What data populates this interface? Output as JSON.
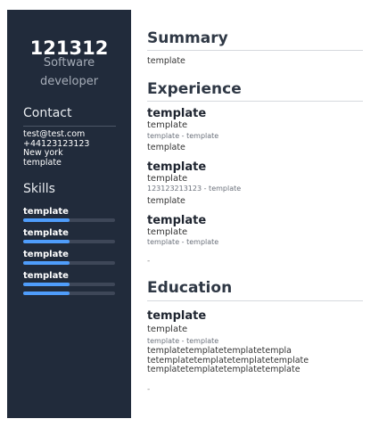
{
  "sidebar": {
    "name": "121312",
    "role_line1": "Software",
    "role_line2": "developer",
    "contact_heading": "Contact",
    "contact": [
      "test@test.com",
      "+44123123123",
      "New york",
      "template"
    ],
    "skills_heading": "Skills",
    "skills": [
      {
        "label": "template",
        "level": 0.5
      },
      {
        "label": "template",
        "level": 0.5
      },
      {
        "label": "template",
        "level": 0.5
      },
      {
        "label": "template",
        "level": 0.5
      }
    ],
    "colors": {
      "background": "#212b3b",
      "skill_fill": "#4f9dfb",
      "skill_track": "#3e4758"
    }
  },
  "summary": {
    "heading": "Summary",
    "text": "template"
  },
  "experience": {
    "heading": "Experience",
    "items": [
      {
        "title": "template",
        "subtitle": "template",
        "meta": "template - template",
        "body": "template"
      },
      {
        "title": "template",
        "subtitle": "template",
        "meta": "123123213123 - template",
        "body": "template"
      },
      {
        "title": "template",
        "subtitle": "template",
        "meta": "template - template",
        "body": "-"
      }
    ]
  },
  "education": {
    "heading": "Education",
    "title": "template",
    "subtitle": "template",
    "meta": "template - template",
    "desc": [
      "templatetemplatetemplatetempla",
      "tetemplatetemplatetemplatetemplate",
      "templatetemplatetemplatetemplate"
    ],
    "trailing": "-"
  }
}
